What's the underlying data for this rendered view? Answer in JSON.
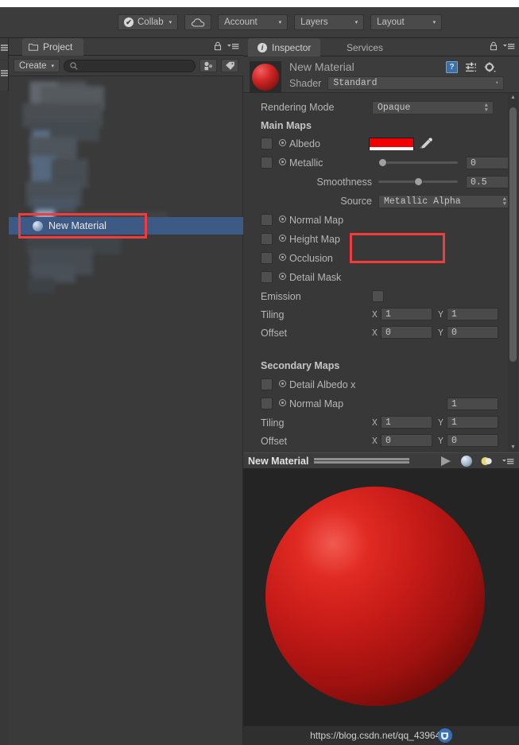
{
  "toolbar": {
    "collab": {
      "label": "Collab",
      "icon": "check-circle-icon",
      "caret": "▾"
    },
    "cloud": {
      "icon": "cloud-icon"
    },
    "account": {
      "label": "Account",
      "caret": "▾"
    },
    "layers": {
      "label": "Layers",
      "caret": "▾"
    },
    "layout": {
      "label": "Layout",
      "caret": "▾"
    }
  },
  "project_panel": {
    "tab_label": "Project",
    "tab_icon": "folder-icon",
    "lock_icon": "lock-icon",
    "menu_icon": "hamburger-menu-icon",
    "create_label": "Create",
    "create_caret": "▾",
    "search_placeholder": "",
    "search_value": "",
    "search_icon": "search-icon",
    "filter_type_icon": "filter-by-type-icon",
    "filter_label_icon": "filter-by-label-icon",
    "selected_asset": {
      "name": "New Material",
      "icon": "material-ball-icon",
      "highlight_color": "#3d5a87",
      "annotation_color": "#f43b3b"
    }
  },
  "inspector": {
    "tabs": [
      {
        "label": "Inspector",
        "icon": "info-icon",
        "active": true
      },
      {
        "label": "Services",
        "icon": "",
        "active": false
      }
    ],
    "lock_icon": "lock-icon",
    "menu_icon": "hamburger-menu-icon",
    "material_name": "New Material",
    "preview_icon": "red-material-ball-icon",
    "header_icons": [
      {
        "name": "help-book-icon",
        "glyph": "?"
      },
      {
        "name": "preset-sliders-icon",
        "glyph": ""
      },
      {
        "name": "gear-icon",
        "glyph": ""
      }
    ],
    "shader": {
      "label": "Shader",
      "value": "Standard",
      "caret": "▾"
    },
    "rendering_mode": {
      "label": "Rendering Mode",
      "value": "Opaque"
    },
    "main_maps_header": "Main Maps",
    "albedo": {
      "label": "Albedo",
      "color_hex": "#F00000",
      "alpha_hex": "#FFFFFF",
      "eyedropper_icon": "eyedropper-icon",
      "annotation_color": "#f43b3b"
    },
    "metallic": {
      "label": "Metallic",
      "value": "0",
      "slider_pct": 0
    },
    "smoothness": {
      "label": "Smoothness",
      "value": "0.5",
      "slider_pct": 50
    },
    "source": {
      "label": "Source",
      "value": "Metallic Alpha"
    },
    "normal_map": {
      "label": "Normal Map"
    },
    "height_map": {
      "label": "Height Map"
    },
    "occlusion": {
      "label": "Occlusion"
    },
    "detail_mask": {
      "label": "Detail Mask"
    },
    "emission": {
      "label": "Emission",
      "checked": false
    },
    "tiling": {
      "label": "Tiling",
      "x_label": "X",
      "x": "1",
      "y_label": "Y",
      "y": "1"
    },
    "offset": {
      "label": "Offset",
      "x_label": "X",
      "x": "0",
      "y_label": "Y",
      "y": "0"
    },
    "secondary_maps_header": "Secondary Maps",
    "detail_albedo": {
      "label": "Detail Albedo x"
    },
    "secondary_normal_map": {
      "label": "Normal Map",
      "value": "1"
    },
    "secondary_tiling": {
      "label": "Tiling",
      "x_label": "X",
      "x": "1",
      "y_label": "Y",
      "y": "1"
    },
    "secondary_offset": {
      "label": "Offset",
      "x_label": "X",
      "x": "0",
      "y_label": "Y",
      "y": "0"
    },
    "scrollbar": {
      "up_arrow": "▲",
      "down_arrow": "▼"
    }
  },
  "preview": {
    "title": "New Material",
    "play_icon": "play-triangle-icon",
    "sphere_icon": "preview-sphere-icon",
    "lighting_icon": "lighting-toggle-icon",
    "menu_icon": "hamburger-menu-icon",
    "drag_handle_icon": "drag-handle-icon",
    "sphere": {
      "name": "material-preview-sphere",
      "color_hex": "#C41A17"
    },
    "watermark": {
      "text": "https://blog.csdn.net/qq_439649",
      "badge_icon": "csdn-logo-icon"
    }
  }
}
